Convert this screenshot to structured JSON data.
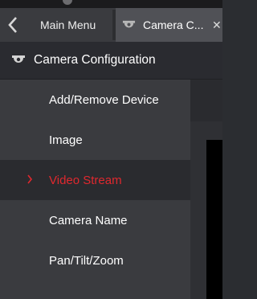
{
  "tabs": {
    "back_icon": "chevron-left-icon",
    "main_menu_label": "Main Menu",
    "active_tab_label": "Camera C...",
    "active_tab_icon": "camera-icon",
    "close_symbol": "✕"
  },
  "section": {
    "icon": "camera-icon",
    "title": "Camera Configuration"
  },
  "menu": {
    "items": [
      {
        "label": "Add/Remove Device",
        "active": false
      },
      {
        "label": "Image",
        "active": false
      },
      {
        "label": "Video Stream",
        "active": true
      },
      {
        "label": "Camera Name",
        "active": false
      },
      {
        "label": "Pan/Tilt/Zoom",
        "active": false
      }
    ]
  },
  "colors": {
    "accent": "#e0282e",
    "menu_bg": "#3a3b3f",
    "header_bg": "#2a2b30",
    "active_tab_bg": "#505156"
  }
}
